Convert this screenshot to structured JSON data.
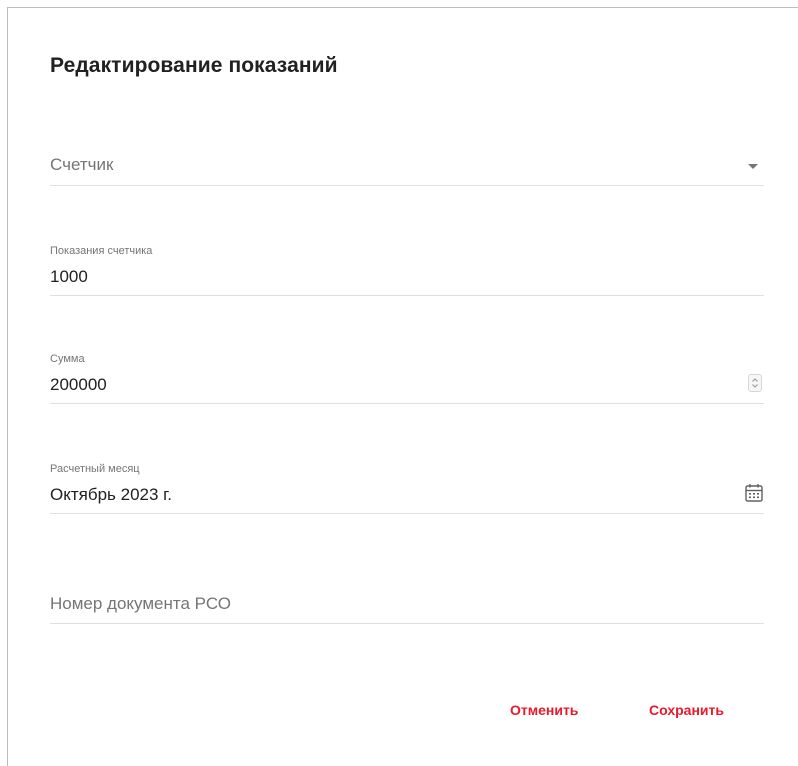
{
  "dialog": {
    "title": "Редактирование показаний"
  },
  "form": {
    "counter": {
      "placeholder": "Счетчик",
      "icon": "chevron-down-icon"
    },
    "reading": {
      "label": "Показания счетчика",
      "value": "1000"
    },
    "sum": {
      "label": "Сумма",
      "value": "200000",
      "icon": "spinner-icon"
    },
    "month": {
      "label": "Расчетный месяц",
      "value": "Октябрь 2023 г.",
      "icon": "calendar-icon"
    },
    "doc_number": {
      "placeholder": "Номер документа РСО"
    }
  },
  "actions": {
    "cancel_label": "Отменить",
    "save_label": "Сохранить"
  },
  "colors": {
    "accent": "#e8192c",
    "text": "#212121",
    "secondary_text": "#757575",
    "divider": "#e0e0e0"
  }
}
